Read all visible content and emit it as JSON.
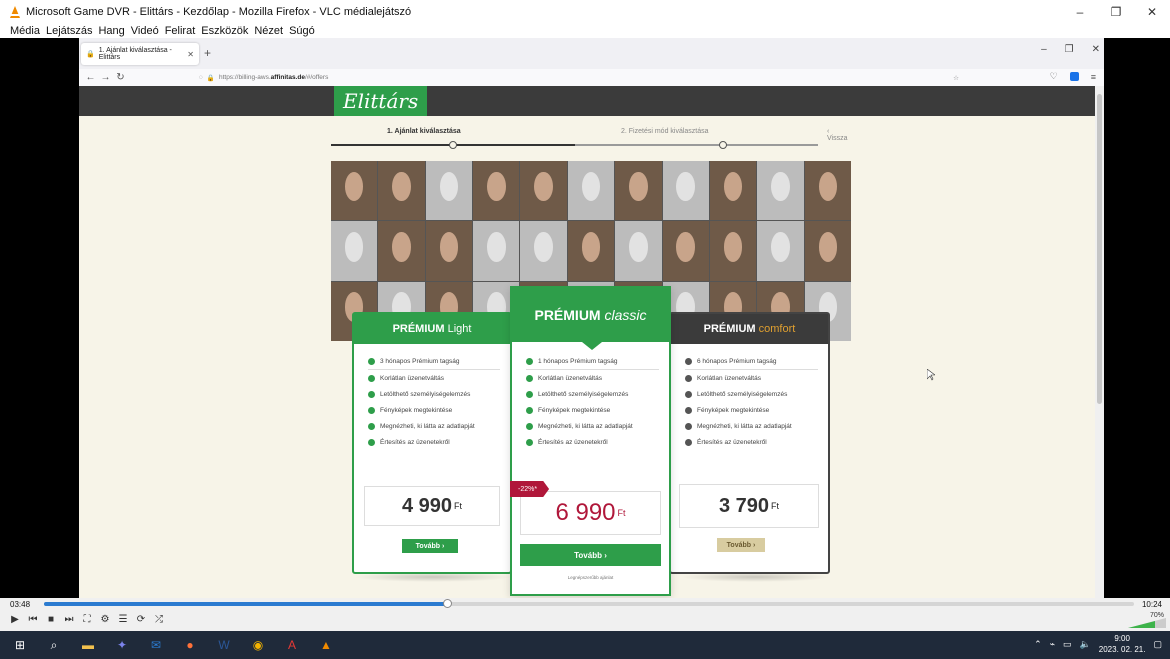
{
  "vlc": {
    "title": "Microsoft Game DVR - Elittárs - Kezdőlap - Mozilla Firefox - VLC médialejátszó",
    "menu": [
      "Média",
      "Lejátszás",
      "Hang",
      "Videó",
      "Felirat",
      "Eszközök",
      "Nézet",
      "Súgó"
    ],
    "time_elapsed": "03:48",
    "time_total": "10:24",
    "progress": 0.37,
    "volume_label": "70%",
    "window_controls": [
      "–",
      "❐",
      "✕"
    ]
  },
  "firefox": {
    "tab_title": "1. Ajánlat kiválasztása - Elittárs",
    "url_prefix": "https://billing-aws.",
    "url_domain": "affinitas.de",
    "url_path": "/#/offers",
    "window_controls": [
      "–",
      "❐",
      "✕"
    ]
  },
  "page": {
    "logo": "Elittárs",
    "step1": "1. Ajánlat kiválasztása",
    "step2": "2. Fizetési mód kiválasztása",
    "back": "‹ Vissza"
  },
  "plans": [
    {
      "name_prefix": "PRÉMIUM",
      "name_suffix": "Light",
      "features": [
        "3 hónapos Prémium tagság",
        "Korlátlan üzenetváltás",
        "Letölthető személyiségelemzés",
        "Fényképek megtekintése",
        "Megnézheti, ki látta az adatlapját",
        "Értesítés az üzenetekről"
      ],
      "price": "4 990",
      "currency": "Ft",
      "button": "Tovább ›"
    },
    {
      "name_prefix": "PRÉMIUM",
      "name_suffix": "classic",
      "features": [
        "1 hónapos Prémium tagság",
        "Korlátlan üzenetváltás",
        "Letölthető személyiségelemzés",
        "Fényképek megtekintése",
        "Megnézheti, ki látta az adatlapját",
        "Értesítés az üzenetekről"
      ],
      "discount": "-22%*",
      "price": "6 990",
      "currency": "Ft",
      "button": "Tovább ›",
      "note": "Legnépszerűbb ajánlat"
    },
    {
      "name_prefix": "PRÉMIUM",
      "name_suffix": "comfort",
      "features": [
        "6 hónapos Prémium tagság",
        "Korlátlan üzenetváltás",
        "Letölthető személyiségelemzés",
        "Fényképek megtekintése",
        "Megnézheti, ki látta az adatlapját",
        "Értesítés az üzenetekről"
      ],
      "price": "3 790",
      "currency": "Ft",
      "button": "Tovább ›"
    }
  ],
  "taskbar": {
    "time": "9:00",
    "date": "2023. 02. 21."
  },
  "colors": {
    "green": "#2e9e4a",
    "dark_header": "#3b3b3b",
    "comfort_gold": "#e0a030",
    "discount_red": "#b0173a",
    "price_red": "#b0173a"
  }
}
